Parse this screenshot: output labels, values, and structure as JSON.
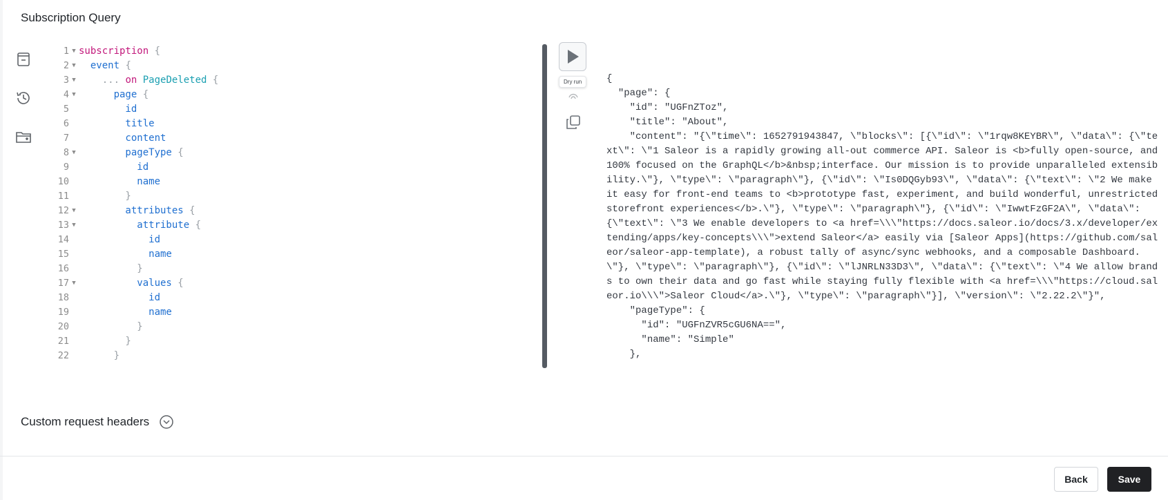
{
  "page": {
    "title": "Subscription Query"
  },
  "sidebar": {
    "icons": [
      "document-icon",
      "history-icon",
      "folder-add-icon"
    ]
  },
  "editor": {
    "lines": [
      {
        "n": "1",
        "fold": true,
        "segments": [
          [
            "kw",
            "subscription"
          ],
          [
            "brace",
            " {"
          ]
        ]
      },
      {
        "n": "2",
        "fold": true,
        "segments": [
          [
            "fld",
            "  event"
          ],
          [
            "brace",
            " {"
          ]
        ]
      },
      {
        "n": "3",
        "fold": true,
        "segments": [
          [
            "brace",
            "    ... "
          ],
          [
            "kw",
            "on"
          ],
          [
            "type",
            " PageDeleted"
          ],
          [
            "brace",
            " {"
          ]
        ]
      },
      {
        "n": "4",
        "fold": true,
        "segments": [
          [
            "fld",
            "      page"
          ],
          [
            "brace",
            " {"
          ]
        ]
      },
      {
        "n": "5",
        "fold": false,
        "segments": [
          [
            "fld",
            "        id"
          ]
        ]
      },
      {
        "n": "6",
        "fold": false,
        "segments": [
          [
            "fld",
            "        title"
          ]
        ]
      },
      {
        "n": "7",
        "fold": false,
        "segments": [
          [
            "fld",
            "        content"
          ]
        ]
      },
      {
        "n": "8",
        "fold": true,
        "segments": [
          [
            "fld",
            "        pageType"
          ],
          [
            "brace",
            " {"
          ]
        ]
      },
      {
        "n": "9",
        "fold": false,
        "segments": [
          [
            "fld",
            "          id"
          ]
        ]
      },
      {
        "n": "10",
        "fold": false,
        "segments": [
          [
            "fld",
            "          name"
          ]
        ]
      },
      {
        "n": "11",
        "fold": false,
        "segments": [
          [
            "brace",
            "        }"
          ]
        ]
      },
      {
        "n": "12",
        "fold": true,
        "segments": [
          [
            "fld",
            "        attributes"
          ],
          [
            "brace",
            " {"
          ]
        ]
      },
      {
        "n": "13",
        "fold": true,
        "segments": [
          [
            "fld",
            "          attribute"
          ],
          [
            "brace",
            " {"
          ]
        ]
      },
      {
        "n": "14",
        "fold": false,
        "segments": [
          [
            "fld",
            "            id"
          ]
        ]
      },
      {
        "n": "15",
        "fold": false,
        "segments": [
          [
            "fld",
            "            name"
          ]
        ]
      },
      {
        "n": "16",
        "fold": false,
        "segments": [
          [
            "brace",
            "          }"
          ]
        ]
      },
      {
        "n": "17",
        "fold": true,
        "segments": [
          [
            "fld",
            "          values"
          ],
          [
            "brace",
            " {"
          ]
        ]
      },
      {
        "n": "18",
        "fold": false,
        "segments": [
          [
            "fld",
            "            id"
          ]
        ]
      },
      {
        "n": "19",
        "fold": false,
        "segments": [
          [
            "fld",
            "            name"
          ]
        ]
      },
      {
        "n": "20",
        "fold": false,
        "segments": [
          [
            "brace",
            "          }"
          ]
        ]
      },
      {
        "n": "21",
        "fold": false,
        "segments": [
          [
            "brace",
            "        }"
          ]
        ]
      },
      {
        "n": "22",
        "fold": false,
        "segments": [
          [
            "brace",
            "      }"
          ]
        ]
      }
    ]
  },
  "toolbar": {
    "run_icon": "play-icon",
    "tooltip": "Dry run",
    "copy_icon": "copy-icon"
  },
  "result": {
    "lines": [
      "{",
      "  \"page\": {",
      "    \"id\": \"UGFnZToz\",",
      "    \"title\": \"About\",",
      "    \"content\": \"{\\\"time\\\": 1652791943847, \\\"blocks\\\": [{\\\"id\\\": \\\"1rqw8KEYBR\\\", \\\"data\\\": {\\\"text\\\": \\\"1 Saleor is a rapidly growing all-out commerce API. Saleor is <b>fully open-source, and 100% focused on the GraphQL</b>&nbsp;interface. Our mission is to provide unparalleled extensibility.\\\"}, \\\"type\\\": \\\"paragraph\\\"}, {\\\"id\\\": \\\"Is0DQGyb93\\\", \\\"data\\\": {\\\"text\\\": \\\"2 We make it easy for front-end teams to <b>prototype fast, experiment, and build wonderful, unrestricted storefront experiences</b>.\\\"}, \\\"type\\\": \\\"paragraph\\\"}, {\\\"id\\\": \\\"IwwtFzGF2A\\\", \\\"data\\\": {\\\"text\\\": \\\"3 We enable developers to <a href=\\\\\\\"https://docs.saleor.io/docs/3.x/developer/extending/apps/key-concepts\\\\\\\">extend Saleor</a> easily via [Saleor Apps](https://github.com/saleor/saleor-app-template), a robust tally of async/sync webhooks, and a composable Dashboard. \\\"}, \\\"type\\\": \\\"paragraph\\\"}, {\\\"id\\\": \\\"lJNRLN33D3\\\", \\\"data\\\": {\\\"text\\\": \\\"4 We allow brands to own their data and go fast while staying fully flexible with <a href=\\\\\\\"https://cloud.saleor.io\\\\\\\">Saleor Cloud</a>.\\\"}, \\\"type\\\": \\\"paragraph\\\"}], \\\"version\\\": \\\"2.22.2\\\"}\",",
      "    \"pageType\": {",
      "      \"id\": \"UGFnZVR5cGU6NA==\",",
      "      \"name\": \"Simple\"",
      "    },"
    ]
  },
  "headers": {
    "label": "Custom request headers"
  },
  "footer": {
    "back_label": "Back",
    "save_label": "Save"
  }
}
